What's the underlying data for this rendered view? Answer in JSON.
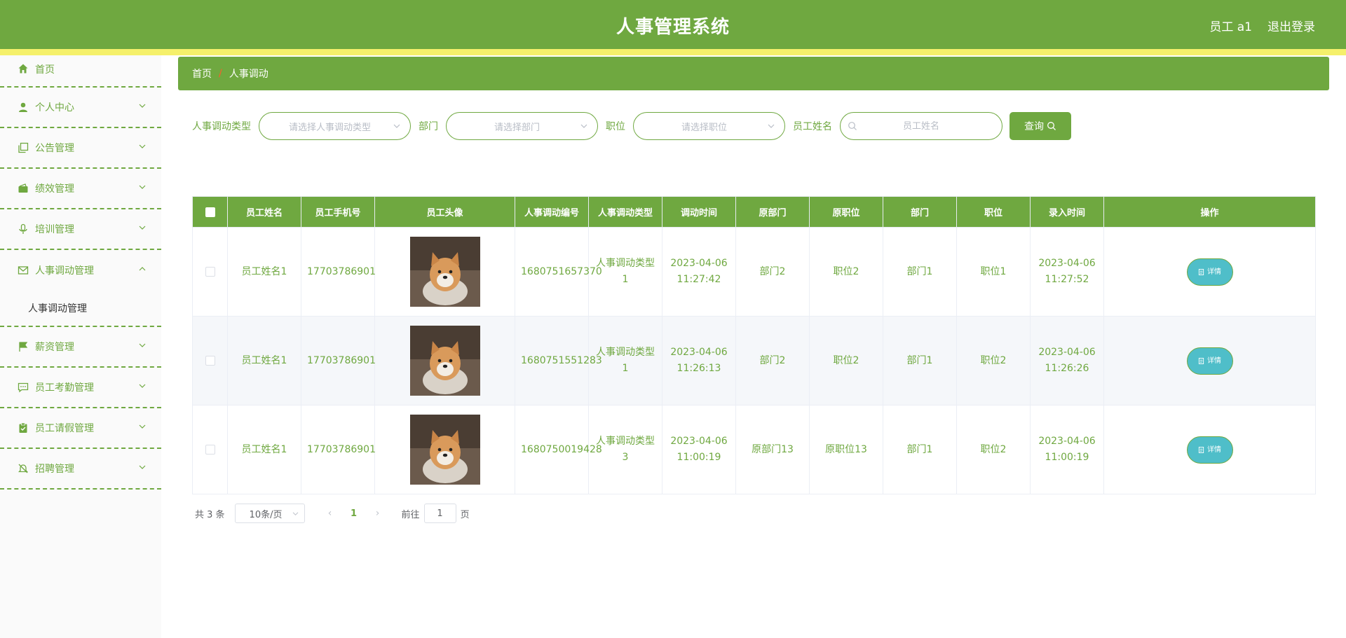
{
  "header": {
    "title": "人事管理系统",
    "user": "员工 a1",
    "logout": "退出登录"
  },
  "sidebar": {
    "items": [
      {
        "label": "首页",
        "icon": "home-icon"
      },
      {
        "label": "个人中心",
        "icon": "user-icon"
      },
      {
        "label": "公告管理",
        "icon": "copy-icon"
      },
      {
        "label": "绩效管理",
        "icon": "wallet-icon"
      },
      {
        "label": "培训管理",
        "icon": "microphone-icon"
      },
      {
        "label": "人事调动管理",
        "icon": "mail-icon",
        "expanded": true,
        "sub": [
          "人事调动管理"
        ]
      },
      {
        "label": "薪资管理",
        "icon": "flag-icon"
      },
      {
        "label": "员工考勤管理",
        "icon": "chat-icon"
      },
      {
        "label": "员工请假管理",
        "icon": "clipboard-icon"
      },
      {
        "label": "招聘管理",
        "icon": "bell-off-icon"
      }
    ]
  },
  "breadcrumb": {
    "home": "首页",
    "sep": "/",
    "current": "人事调动"
  },
  "filters": {
    "type_label": "人事调动类型",
    "type_placeholder": "请选择人事调动类型",
    "dept_label": "部门",
    "dept_placeholder": "请选择部门",
    "pos_label": "职位",
    "pos_placeholder": "请选择职位",
    "name_label": "员工姓名",
    "name_placeholder": "员工姓名",
    "query_label": "查询"
  },
  "table": {
    "headers": [
      "员工姓名",
      "员工手机号",
      "员工头像",
      "人事调动编号",
      "人事调动类型",
      "调动时间",
      "原部门",
      "原职位",
      "部门",
      "职位",
      "录入时间",
      "操作"
    ],
    "detail_label": "详情",
    "rows": [
      {
        "name": "员工姓名1",
        "phone": "17703786901",
        "code": "1680751657370",
        "type": "人事调动类型1",
        "time": "2023-04-06 11:27:42",
        "old_dept": "部门2",
        "old_pos": "职位2",
        "dept": "部门1",
        "pos": "职位1",
        "created": "2023-04-06 11:27:52"
      },
      {
        "name": "员工姓名1",
        "phone": "17703786901",
        "code": "1680751551283",
        "type": "人事调动类型1",
        "time": "2023-04-06 11:26:13",
        "old_dept": "部门2",
        "old_pos": "职位2",
        "dept": "部门1",
        "pos": "职位2",
        "created": "2023-04-06 11:26:26"
      },
      {
        "name": "员工姓名1",
        "phone": "17703786901",
        "code": "1680750019428",
        "type": "人事调动类型3",
        "time": "2023-04-06 11:00:19",
        "old_dept": "原部门13",
        "old_pos": "原职位13",
        "dept": "部门1",
        "pos": "职位2",
        "created": "2023-04-06 11:00:19"
      }
    ]
  },
  "pagination": {
    "total": "共 3 条",
    "page_size": "10条/页",
    "current": "1",
    "goto": "前往",
    "jump_value": "1",
    "page_unit": "页"
  },
  "colors": {
    "primary": "#6fa840",
    "stripe": "#f5f06b",
    "detail_button": "#4fbec9"
  }
}
